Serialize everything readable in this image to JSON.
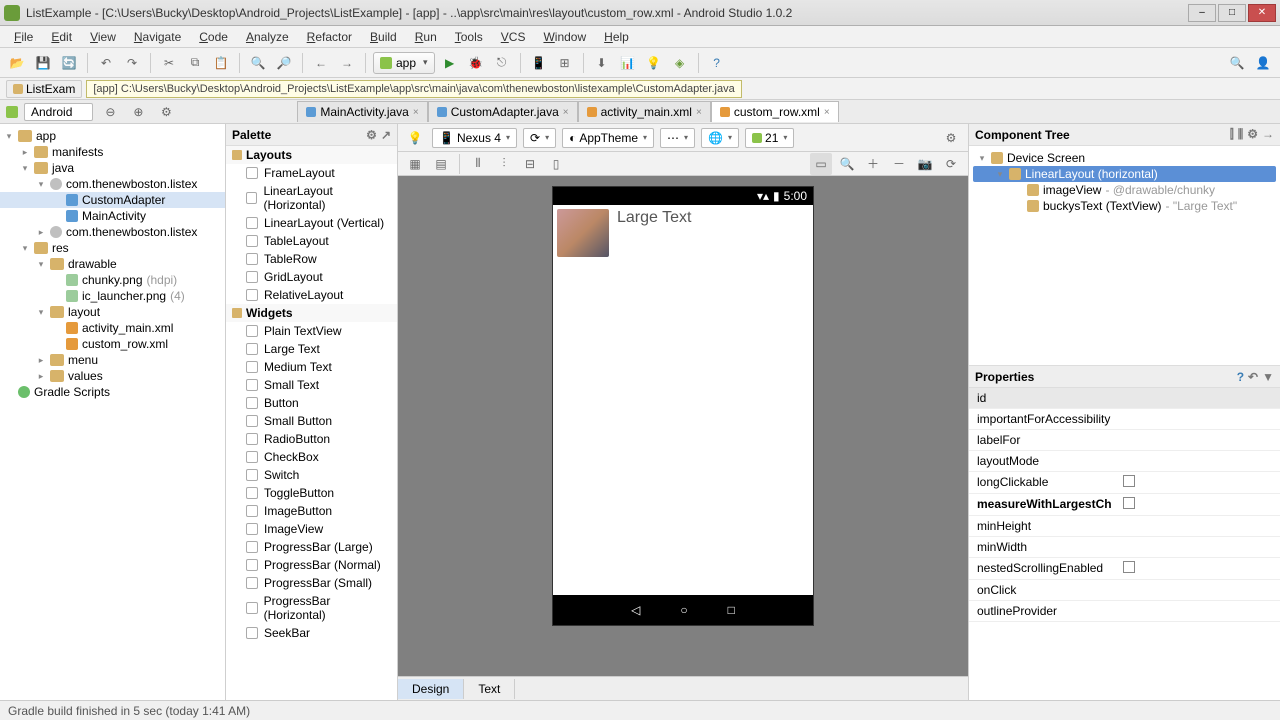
{
  "window": {
    "title": "ListExample - [C:\\Users\\Bucky\\Desktop\\Android_Projects\\ListExample] - [app] - ..\\app\\src\\main\\res\\layout\\custom_row.xml - Android Studio 1.0.2"
  },
  "menu": [
    "File",
    "Edit",
    "View",
    "Navigate",
    "Code",
    "Analyze",
    "Refactor",
    "Build",
    "Run",
    "Tools",
    "VCS",
    "Window",
    "Help"
  ],
  "toolbar": {
    "app_label": "app"
  },
  "path": {
    "chip": "ListExam",
    "tooltip": "[app] C:\\Users\\Bucky\\Desktop\\Android_Projects\\ListExample\\app\\src\\main\\java\\com\\thenewboston\\listexample\\CustomAdapter.java"
  },
  "nav": {
    "selector": "Android",
    "tabs": [
      {
        "label": "MainActivity.java",
        "kind": "java",
        "active": false
      },
      {
        "label": "CustomAdapter.java",
        "kind": "java",
        "active": false
      },
      {
        "label": "activity_main.xml",
        "kind": "xml",
        "active": false
      },
      {
        "label": "custom_row.xml",
        "kind": "xml",
        "active": true
      }
    ]
  },
  "tree": {
    "nodes": [
      {
        "d": 0,
        "open": true,
        "icon": "folder",
        "label": "app"
      },
      {
        "d": 1,
        "open": false,
        "icon": "folder",
        "label": "manifests"
      },
      {
        "d": 1,
        "open": true,
        "icon": "folder",
        "label": "java"
      },
      {
        "d": 2,
        "open": true,
        "icon": "pkg",
        "label": "com.thenewboston.listex"
      },
      {
        "d": 3,
        "open": false,
        "icon": "java",
        "label": "CustomAdapter",
        "sel": true
      },
      {
        "d": 3,
        "open": false,
        "icon": "java",
        "label": "MainActivity"
      },
      {
        "d": 2,
        "open": false,
        "icon": "pkg",
        "label": "com.thenewboston.listex"
      },
      {
        "d": 1,
        "open": true,
        "icon": "folder",
        "label": "res"
      },
      {
        "d": 2,
        "open": true,
        "icon": "folder",
        "label": "drawable"
      },
      {
        "d": 3,
        "open": false,
        "icon": "img",
        "label": "chunky.png",
        "hint": "(hdpi)"
      },
      {
        "d": 3,
        "open": false,
        "icon": "img",
        "label": "ic_launcher.png",
        "hint": "(4)"
      },
      {
        "d": 2,
        "open": true,
        "icon": "folder",
        "label": "layout"
      },
      {
        "d": 3,
        "open": false,
        "icon": "xml",
        "label": "activity_main.xml"
      },
      {
        "d": 3,
        "open": false,
        "icon": "xml",
        "label": "custom_row.xml"
      },
      {
        "d": 2,
        "open": false,
        "icon": "folder",
        "label": "menu"
      },
      {
        "d": 2,
        "open": false,
        "icon": "folder",
        "label": "values"
      },
      {
        "d": 0,
        "open": false,
        "icon": "gradle",
        "label": "Gradle Scripts"
      }
    ]
  },
  "palette": {
    "title": "Palette",
    "groups": [
      {
        "name": "Layouts",
        "items": [
          "FrameLayout",
          "LinearLayout (Horizontal)",
          "LinearLayout (Vertical)",
          "TableLayout",
          "TableRow",
          "GridLayout",
          "RelativeLayout"
        ]
      },
      {
        "name": "Widgets",
        "items": [
          "Plain TextView",
          "Large Text",
          "Medium Text",
          "Small Text",
          "Button",
          "Small Button",
          "RadioButton",
          "CheckBox",
          "Switch",
          "ToggleButton",
          "ImageButton",
          "ImageView",
          "ProgressBar (Large)",
          "ProgressBar (Normal)",
          "ProgressBar (Small)",
          "ProgressBar (Horizontal)",
          "SeekBar"
        ]
      }
    ]
  },
  "designer": {
    "device": "Nexus 4",
    "theme": "AppTheme",
    "api": "21",
    "status_time": "5:00",
    "preview_text": "Large Text",
    "mode_tabs": [
      "Design",
      "Text"
    ],
    "active_mode": "Design"
  },
  "comptree": {
    "title": "Component Tree",
    "nodes": [
      {
        "d": 0,
        "label": "Device Screen",
        "icon": "device"
      },
      {
        "d": 1,
        "label": "LinearLayout (horizontal)",
        "icon": "layout",
        "sel": true
      },
      {
        "d": 2,
        "label": "imageView",
        "hint": "- @drawable/chunky",
        "icon": "image"
      },
      {
        "d": 2,
        "label": "buckysText (TextView)",
        "hint": "- \"Large Text\"",
        "icon": "text"
      }
    ]
  },
  "properties": {
    "title": "Properties",
    "rows": [
      {
        "name": "id",
        "val": "",
        "hdr": true
      },
      {
        "name": "importantForAccessibility",
        "val": ""
      },
      {
        "name": "labelFor",
        "val": ""
      },
      {
        "name": "layoutMode",
        "val": ""
      },
      {
        "name": "longClickable",
        "val": "",
        "check": true
      },
      {
        "name": "measureWithLargestCh",
        "val": "",
        "check": true,
        "bold": true
      },
      {
        "name": "minHeight",
        "val": ""
      },
      {
        "name": "minWidth",
        "val": ""
      },
      {
        "name": "nestedScrollingEnabled",
        "val": "",
        "check": true
      },
      {
        "name": "onClick",
        "val": ""
      },
      {
        "name": "outlineProvider",
        "val": ""
      }
    ]
  },
  "status": {
    "text": "Gradle build finished in 5 sec (today 1:41 AM)"
  }
}
